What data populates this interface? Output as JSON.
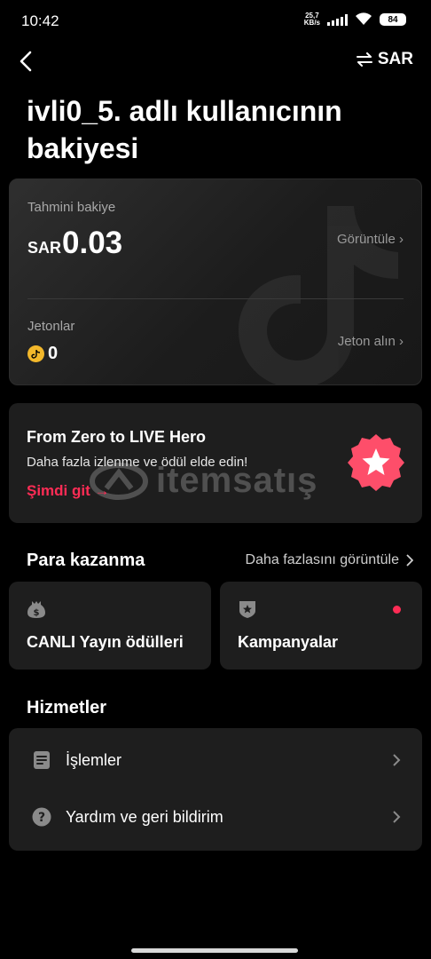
{
  "status_bar": {
    "time": "10:42",
    "net_speed_value": "25,7",
    "net_speed_unit": "KB/s",
    "battery": "84"
  },
  "nav": {
    "back_icon": "chevron-left-icon",
    "currency_label": "SAR",
    "currency_icon": "swap-arrows-icon"
  },
  "page": {
    "title": "ivli0_5. adlı kullanıcının bakiyesi"
  },
  "balance_card": {
    "estimated_label": "Tahmini bakiye",
    "currency": "SAR",
    "amount": "0.03",
    "view_link": "Görüntüle ›",
    "coins_label": "Jetonlar",
    "coins_amount": "0",
    "get_coins_link": "Jeton alın ›"
  },
  "promo": {
    "title": "From Zero to LIVE Hero",
    "subtitle": "Daha fazla izlenme ve ödül elde edin!",
    "cta": "Şimdi git →",
    "badge_icon": "star-badge-icon",
    "watermark_text": "itemsatış"
  },
  "earn": {
    "heading": "Para kazanma",
    "see_more": "Daha fazlasını görüntüle",
    "tiles": [
      {
        "label": "CANLI Yayın ödülleri",
        "icon": "money-bag-icon"
      },
      {
        "label": "Kampanyalar",
        "icon": "shield-star-icon",
        "has_dot": true
      }
    ]
  },
  "services": {
    "heading": "Hizmetler",
    "items": [
      {
        "label": "İşlemler",
        "icon": "document-icon"
      },
      {
        "label": "Yardım ve geri bildirim",
        "icon": "help-icon"
      }
    ]
  },
  "colors": {
    "accent": "#fe2c55",
    "card_bg": "#1e1e1e",
    "coin": "#f3b82b"
  }
}
